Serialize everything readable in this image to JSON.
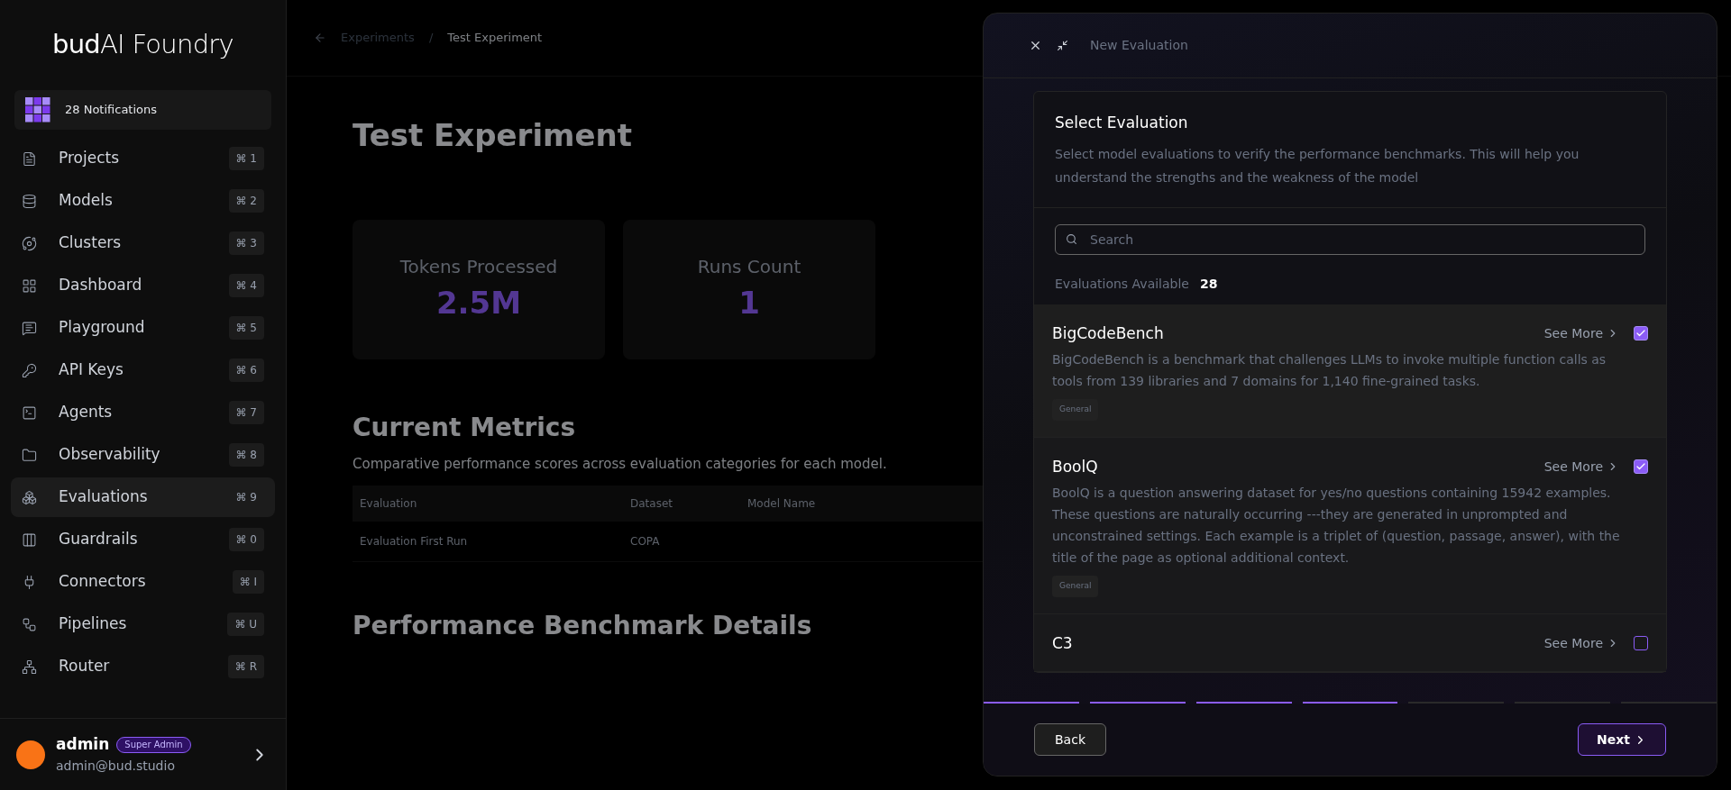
{
  "sidebar": {
    "logo": "**bud**AI Foundry",
    "notifications": "28 Notifications",
    "items": [
      {
        "label": "Projects",
        "shortcut": "⌘ 1",
        "selected": false
      },
      {
        "label": "Models",
        "shortcut": "⌘ 2",
        "selected": false
      },
      {
        "label": "Clusters",
        "shortcut": "⌘ 3",
        "selected": false
      },
      {
        "label": "Dashboard",
        "shortcut": "⌘ 4",
        "selected": false
      },
      {
        "label": "Playground",
        "shortcut": "⌘ 5",
        "selected": false
      },
      {
        "label": "API Keys",
        "shortcut": "⌘ 6",
        "selected": false
      },
      {
        "label": "Agents",
        "shortcut": "⌘ 7",
        "selected": false
      },
      {
        "label": "Observability",
        "shortcut": "⌘ 8",
        "selected": false
      },
      {
        "label": "Evaluations",
        "shortcut": "⌘ 9",
        "selected": true
      },
      {
        "label": "Guardrails",
        "shortcut": "⌘ 0",
        "selected": false
      },
      {
        "label": "Connectors",
        "shortcut": "⌘ I",
        "selected": false
      },
      {
        "label": "Pipelines",
        "shortcut": "⌘ U",
        "selected": false
      },
      {
        "label": "Router",
        "shortcut": "⌘ R",
        "selected": false
      }
    ],
    "user": {
      "name": "admin",
      "role": "Super Admin",
      "email": "admin@bud.studio"
    }
  },
  "background": {
    "breadcrumb": [
      "Experiments",
      "Test Experiment"
    ],
    "separator": "/",
    "title": "Test Experiment",
    "stats": [
      {
        "label": "Tokens Processed",
        "value": "2.5M"
      },
      {
        "label": "Runs Count",
        "value": "1"
      }
    ],
    "metrics_title": "Current Metrics",
    "metrics_subtitle": "Comparative performance scores across evaluation categories for each model.",
    "table": {
      "columns": [
        "Evaluation",
        "Dataset",
        "Model Name"
      ],
      "rows": [
        [
          "Evaluation First Run",
          "COPA",
          ""
        ]
      ]
    },
    "benchmark_title": "Performance Benchmark Details"
  },
  "drawer": {
    "title": "New Evaluation",
    "heading": "Select Evaluation",
    "description": "Select model evaluations to verify the performance benchmarks. This will help you understand the strengths and the weakness of the model",
    "search": {
      "placeholder": "Search"
    },
    "available_label": "Evaluations Available",
    "available_count": "28",
    "evaluations": [
      {
        "name": "BigCodeBench",
        "see_more": "See More",
        "checked": true,
        "description": "BigCodeBench is a benchmark that challenges LLMs to invoke multiple function calls as tools from 139 libraries and 7 domains for 1,140 fine-grained tasks.",
        "tags": [
          "General"
        ]
      },
      {
        "name": "BoolQ",
        "see_more": "See More",
        "checked": true,
        "description": "BoolQ is a question answering dataset for yes/no questions containing 15942 examples. These questions are naturally occurring ---they are generated in unprompted and unconstrained settings. Each example is a triplet of (question, passage, answer), with the title of the page as optional additional context.",
        "tags": [
          "General"
        ]
      },
      {
        "name": "C3",
        "see_more": "See More",
        "checked": false
      }
    ],
    "steps": [
      {
        "done": true
      },
      {
        "done": true
      },
      {
        "done": true
      },
      {
        "done": true
      },
      {
        "done": false
      },
      {
        "done": false
      },
      {
        "done": false
      }
    ],
    "back": "Back",
    "next": "Next"
  }
}
